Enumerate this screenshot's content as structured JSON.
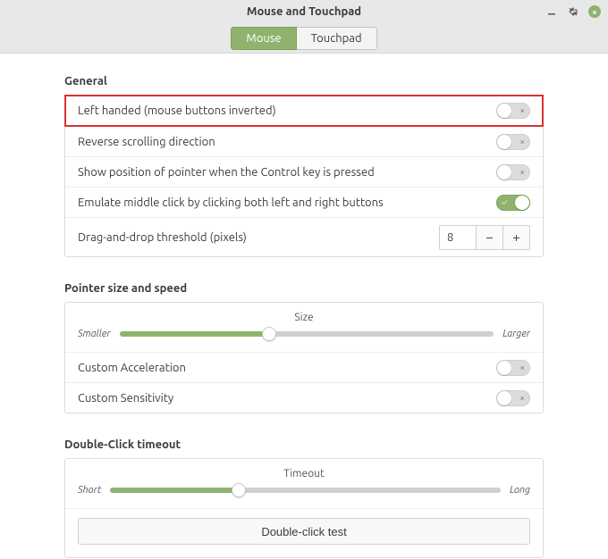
{
  "window": {
    "title": "Mouse and Touchpad"
  },
  "tabs": {
    "mouse": "Mouse",
    "touchpad": "Touchpad",
    "active": "mouse"
  },
  "sections": {
    "general": {
      "title": "General",
      "left_handed": {
        "label": "Left handed (mouse buttons inverted)",
        "on": false,
        "highlight": true
      },
      "reverse_scroll": {
        "label": "Reverse scrolling direction",
        "on": false
      },
      "show_pointer": {
        "label": "Show position of pointer when the Control key is pressed",
        "on": false
      },
      "emulate_middle": {
        "label": "Emulate middle click by clicking both left and right buttons",
        "on": true
      },
      "dnd_threshold": {
        "label": "Drag-and-drop threshold (pixels)",
        "value": "8"
      }
    },
    "pointer": {
      "title": "Pointer size and speed",
      "size": {
        "title": "Size",
        "min_label": "Smaller",
        "max_label": "Larger",
        "percent": 40
      },
      "accel": {
        "label": "Custom Acceleration",
        "on": false
      },
      "sens": {
        "label": "Custom Sensitivity",
        "on": false
      }
    },
    "dblclick": {
      "title": "Double-Click timeout",
      "timeout": {
        "title": "Timeout",
        "min_label": "Short",
        "max_label": "Long",
        "percent": 33
      },
      "test_label": "Double-click test"
    }
  },
  "colors": {
    "accent": "#8fb36f",
    "highlight": "#d33"
  }
}
